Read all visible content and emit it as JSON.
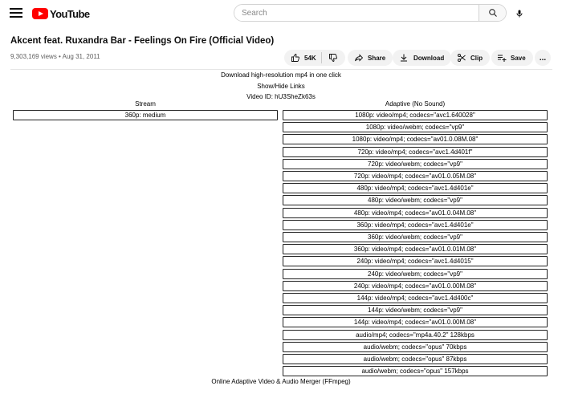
{
  "header": {
    "logo_text": "YouTube",
    "search_placeholder": "Search"
  },
  "video": {
    "title": "Akcent feat. Ruxandra Bar - Feelings On Fire (Official Video)",
    "meta": "9,303,169 views • Aug 31, 2011",
    "likes": "54K",
    "actions": {
      "share": "Share",
      "download": "Download",
      "clip": "Clip",
      "save": "Save",
      "more": "..."
    }
  },
  "downloader": {
    "headline": "Download high-resolution mp4 in one click",
    "toggle_links": "Show/Hide Links",
    "video_id": "Video ID: hU3SheZk63s",
    "stream_heading": "Stream",
    "adaptive_heading": "Adaptive (No Sound)",
    "stream_links": [
      "360p: medium"
    ],
    "adaptive_links": [
      "1080p: video/mp4; codecs=\"avc1.640028\"",
      "1080p: video/webm; codecs=\"vp9\"",
      "1080p: video/mp4; codecs=\"av01.0.08M.08\"",
      "720p: video/mp4; codecs=\"avc1.4d401f\"",
      "720p: video/webm; codecs=\"vp9\"",
      "720p: video/mp4; codecs=\"av01.0.05M.08\"",
      "480p: video/mp4; codecs=\"avc1.4d401e\"",
      "480p: video/webm; codecs=\"vp9\"",
      "480p: video/mp4; codecs=\"av01.0.04M.08\"",
      "360p: video/mp4; codecs=\"avc1.4d401e\"",
      "360p: video/webm; codecs=\"vp9\"",
      "360p: video/mp4; codecs=\"av01.0.01M.08\"",
      "240p: video/mp4; codecs=\"avc1.4d4015\"",
      "240p: video/webm; codecs=\"vp9\"",
      "240p: video/mp4; codecs=\"av01.0.00M.08\"",
      "144p: video/mp4; codecs=\"avc1.4d400c\"",
      "144p: video/webm; codecs=\"vp9\"",
      "144p: video/mp4; codecs=\"av01.0.00M.08\"",
      "audio/mp4; codecs=\"mp4a.40.2\" 128kbps",
      "audio/webm; codecs=\"opus\" 70kbps",
      "audio/webm; codecs=\"opus\" 87kbps",
      "audio/webm; codecs=\"opus\" 157kbps"
    ],
    "merger_link": "Online Adaptive Video & Audio Merger (FFmpeg)"
  },
  "icons": {
    "menu": "menu-icon",
    "search": "search-icon",
    "mic": "microphone-icon",
    "like": "thumbs-up-icon",
    "dislike": "thumbs-down-icon",
    "share": "share-arrow-icon",
    "download": "download-icon",
    "clip": "scissors-icon",
    "save": "playlist-add-icon",
    "more": "more-horizontal-icon"
  },
  "colors": {
    "brand": "#ff0000",
    "pill_bg": "#f2f2f2",
    "meta_text": "#606060"
  }
}
